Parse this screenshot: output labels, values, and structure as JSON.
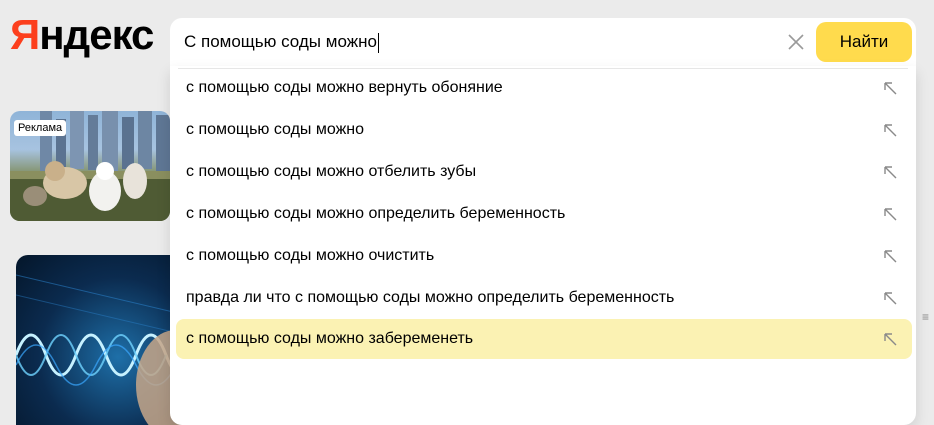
{
  "logo": {
    "first_letter": "Я",
    "rest": "ндекс"
  },
  "search": {
    "query": "С помощью соды можно",
    "button_label": "Найти"
  },
  "ad": {
    "label": "Реклама"
  },
  "suggestions": [
    {
      "text": "с помощью соды можно вернуть обоняние",
      "active": false
    },
    {
      "text": "с помощью соды можно",
      "active": false
    },
    {
      "text": "с помощью соды можно отбелить зубы",
      "active": false
    },
    {
      "text": "с помощью соды можно определить беременность",
      "active": false
    },
    {
      "text": "с помощью соды можно очистить",
      "active": false
    },
    {
      "text": "правда ли что с помощью соды можно определить беременность",
      "active": false
    },
    {
      "text": "с помощью соды можно забеременеть",
      "active": true
    }
  ],
  "colors": {
    "brand_red": "#fc3f1d",
    "button_yellow": "#ffdb4d",
    "active_highlight": "#fbf2b3"
  }
}
